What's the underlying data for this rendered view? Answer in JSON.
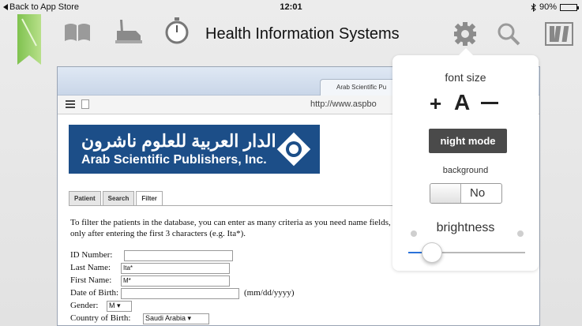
{
  "status_bar": {
    "back_label": "Back to App Store",
    "time": "12:01",
    "battery": "90%",
    "battery_level": 0.9
  },
  "toolbar": {
    "title": "Health Information Systems",
    "icons": [
      "bookmark-ribbon-icon",
      "book-icon",
      "hand-pen-icon",
      "stopwatch-icon",
      "gear-icon",
      "search-icon",
      "library-icon"
    ]
  },
  "document": {
    "browser_tab": "Arab Scientific Pu",
    "url": "http://www.aspbo",
    "logo": {
      "arabic": "الدار العربية للعلوم ناشرون",
      "english": "Arab Scientific Publishers, Inc."
    },
    "tabs": [
      {
        "label": "Patient",
        "active": false
      },
      {
        "label": "Search",
        "active": false
      },
      {
        "label": "Filter",
        "active": true
      }
    ],
    "intro": "To filter the patients in the database, you can enter as many criteria as you need name fields, but only after entering the first 3 characters (e.g. Ita*).",
    "fields": {
      "id_number": {
        "label": "ID Number:",
        "value": ""
      },
      "last_name": {
        "label": "Last Name:",
        "value": "Ita*"
      },
      "first_name": {
        "label": "First Name:",
        "value": "M*"
      },
      "date_of_birth": {
        "label": "Date of Birth:",
        "value": "",
        "hint": "(mm/dd/yyyy)"
      },
      "gender": {
        "label": "Gender:",
        "value": "M"
      },
      "country_of_birth": {
        "label": "Country of Birth:",
        "value": "Saudi Arabia"
      }
    }
  },
  "settings_popover": {
    "font_size_label": "font size",
    "increase_label": "+",
    "font_glyph": "A",
    "night_mode_label": "night mode",
    "background_label": "background",
    "background_value": "No",
    "brightness_label": "brightness",
    "brightness_level": 0.2,
    "accent_color": "#2a72d9"
  }
}
